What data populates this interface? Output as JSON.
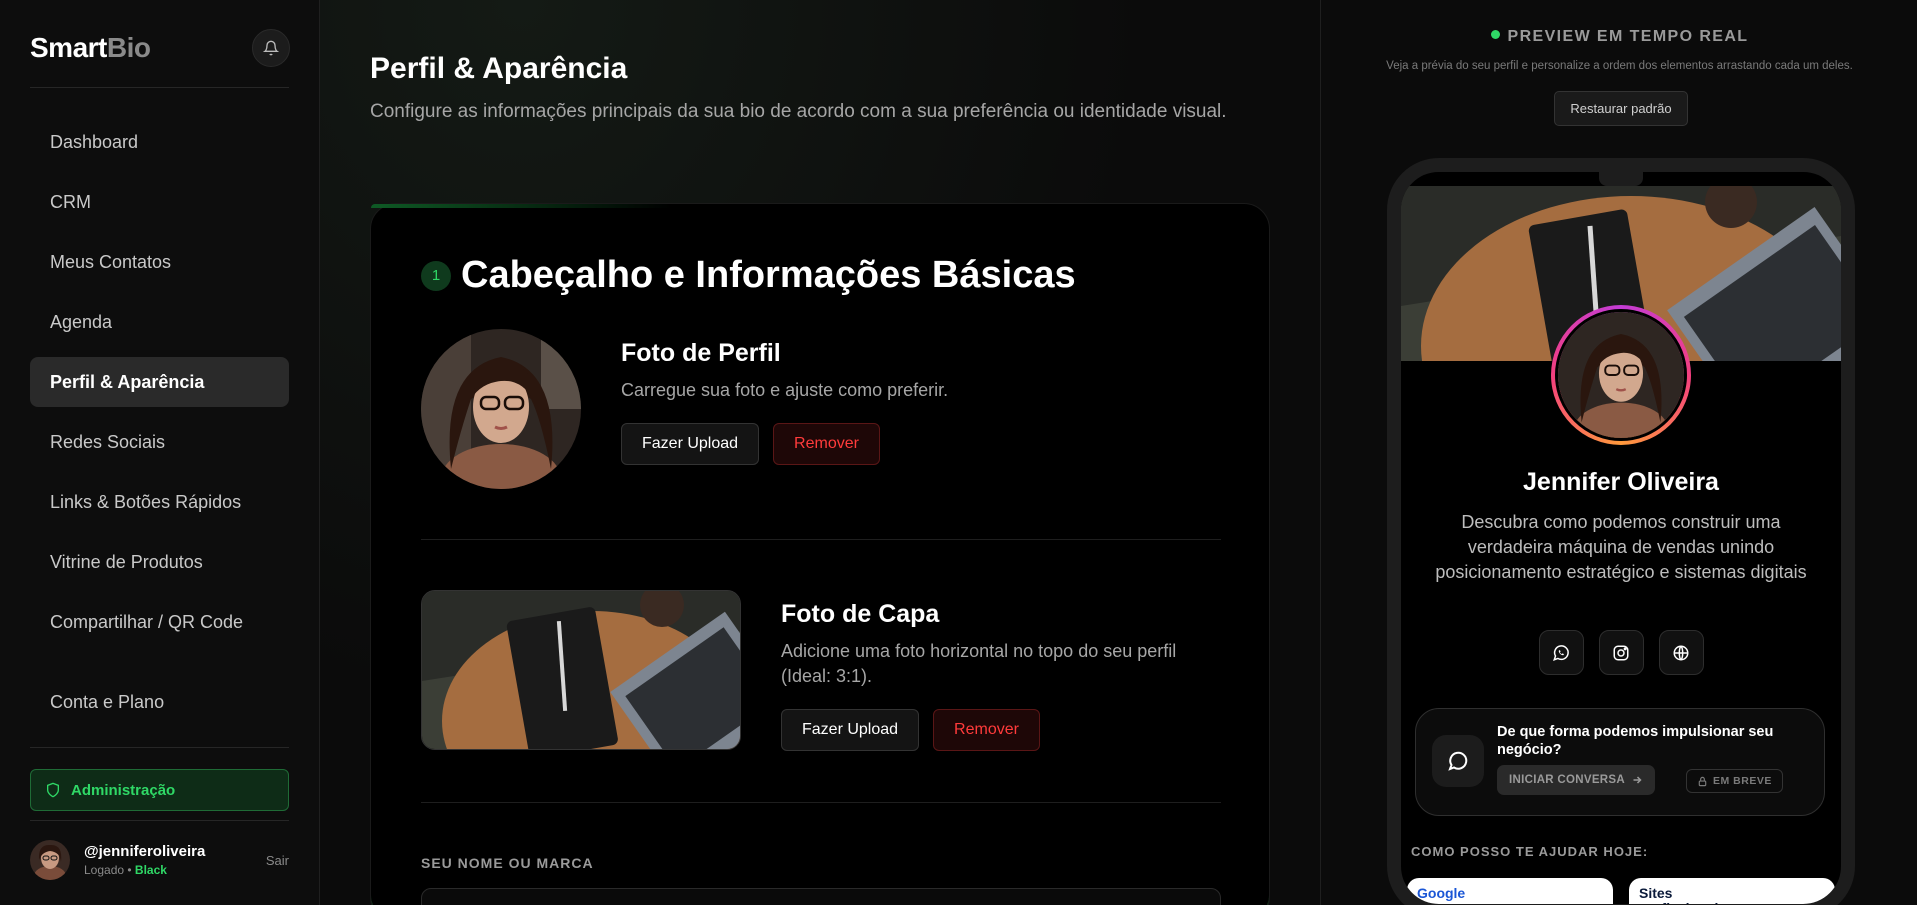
{
  "brand": {
    "name_main": "Smart",
    "name_accent": "Bio"
  },
  "sidebar": {
    "items": [
      {
        "label": "Dashboard"
      },
      {
        "label": "CRM"
      },
      {
        "label": "Meus Contatos"
      },
      {
        "label": "Agenda"
      },
      {
        "label": "Perfil & Aparência"
      },
      {
        "label": "Redes Sociais"
      },
      {
        "label": "Links & Botões Rápidos"
      },
      {
        "label": "Vitrine de Produtos"
      },
      {
        "label": "Compartilhar / QR Code"
      }
    ],
    "account": "Conta e Plano",
    "admin": "Administração",
    "active_index": 4
  },
  "user": {
    "handle": "@jenniferoliveira",
    "status_prefix": "Logado •",
    "plan": "Black",
    "logout": "Sair"
  },
  "page": {
    "title": "Perfil & Aparência",
    "description": "Configure as informações principais da sua bio de acordo com a sua preferência ou identidade visual."
  },
  "section": {
    "number": "1",
    "title": "Cabeçalho e Informações Básicas",
    "profile_photo": {
      "title": "Foto de Perfil",
      "desc": "Carregue sua foto e ajuste como preferir.",
      "upload": "Fazer Upload",
      "remove": "Remover"
    },
    "cover_photo": {
      "title": "Foto de Capa",
      "desc": "Adicione uma foto horizontal no topo do seu perfil (Ideal: 3:1).",
      "upload": "Fazer Upload",
      "remove": "Remover"
    },
    "name_label": "SEU NOME OU MARCA"
  },
  "preview": {
    "title": "PREVIEW EM TEMPO REAL",
    "subtitle": "Veja a prévia do seu perfil e personalize a ordem dos elementos arrastando cada um deles.",
    "restore": "Restaurar padrão",
    "name": "Jennifer Oliveira",
    "bio": "Descubra como podemos construir uma verdadeira máquina de vendas unindo posicionamento estratégico e sistemas digitais",
    "socials": [
      "whatsapp-icon",
      "instagram-icon",
      "globe-icon"
    ],
    "cta": {
      "question": "De que forma podemos impulsionar seu negócio?",
      "start": "INICIAR CONVERSA",
      "soon": "EM BREVE"
    },
    "help_title": "COMO POSSO TE AJUDAR HOJE:",
    "cards": [
      {
        "title": "Google"
      },
      {
        "title": "Sites profissionais que geram"
      }
    ]
  },
  "colors": {
    "accent": "#2fd866",
    "danger": "#ff3b3b",
    "background": "#0a0a0a"
  }
}
